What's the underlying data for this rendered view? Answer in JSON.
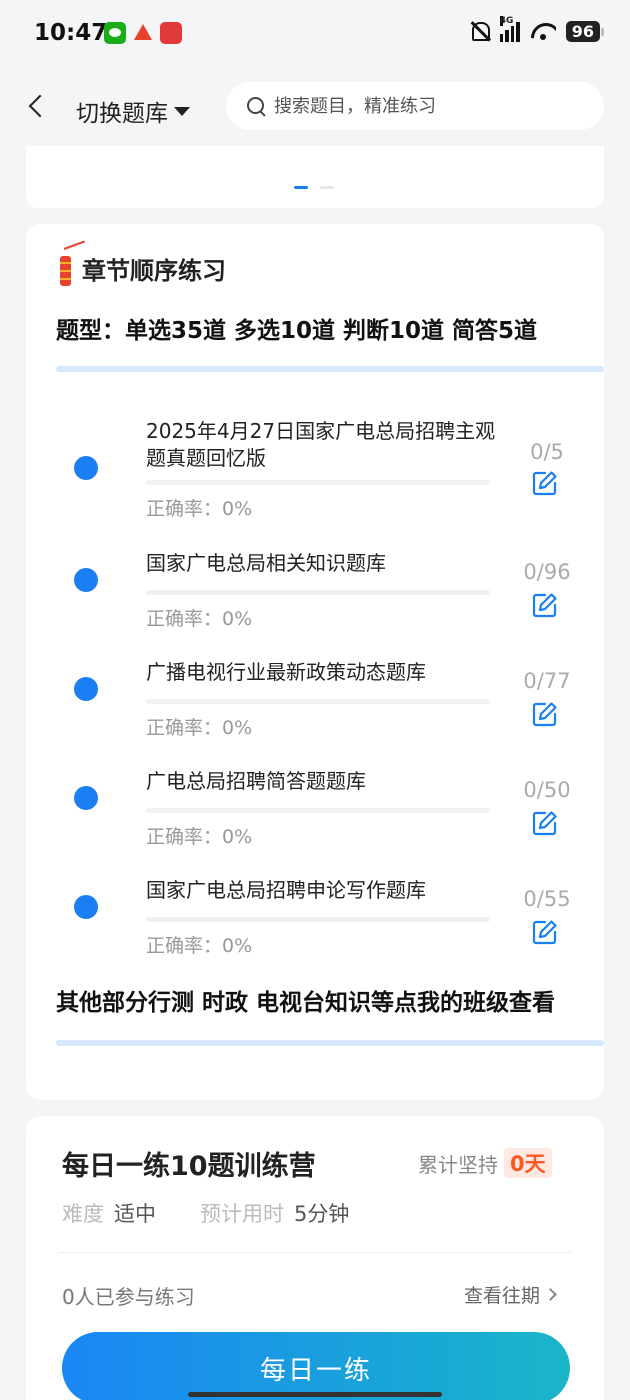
{
  "status_bar": {
    "time": "10:47",
    "network": "4G",
    "battery": "96"
  },
  "header": {
    "switch_label": "切换题库",
    "search_placeholder": "搜索题目，精准练习"
  },
  "chapter": {
    "title": "章节顺序练习",
    "type_summary": "题型：单选35道 多选10道 判断10道 简答5道",
    "items": [
      {
        "name": "2025年4月27日国家广电总局招聘主观题真题回忆版",
        "accuracy": "正确率：0%",
        "count": "0/5"
      },
      {
        "name": "国家广电总局相关知识题库",
        "accuracy": "正确率：0%",
        "count": "0/96"
      },
      {
        "name": "广播电视行业最新政策动态题库",
        "accuracy": "正确率：0%",
        "count": "0/77"
      },
      {
        "name": "广电总局招聘简答题题库",
        "accuracy": "正确率：0%",
        "count": "0/50"
      },
      {
        "name": "国家广电总局招聘申论写作题库",
        "accuracy": "正确率：0%",
        "count": "0/55"
      }
    ],
    "other_note": "其他部分行测 时政 电视台知识等点我的班级查看"
  },
  "daily": {
    "title": "每日一练10题训练营",
    "persist_label": "累计坚持",
    "persist_days": "0天",
    "difficulty_label": "难度",
    "difficulty_value": "适中",
    "time_label": "预计用时",
    "time_value": "5分钟",
    "participants": "0人已参与练习",
    "history_link": "查看往期",
    "button_label": "每日一练"
  },
  "colors": {
    "accent": "#1a7ff2",
    "badge_text": "#ff5722"
  }
}
